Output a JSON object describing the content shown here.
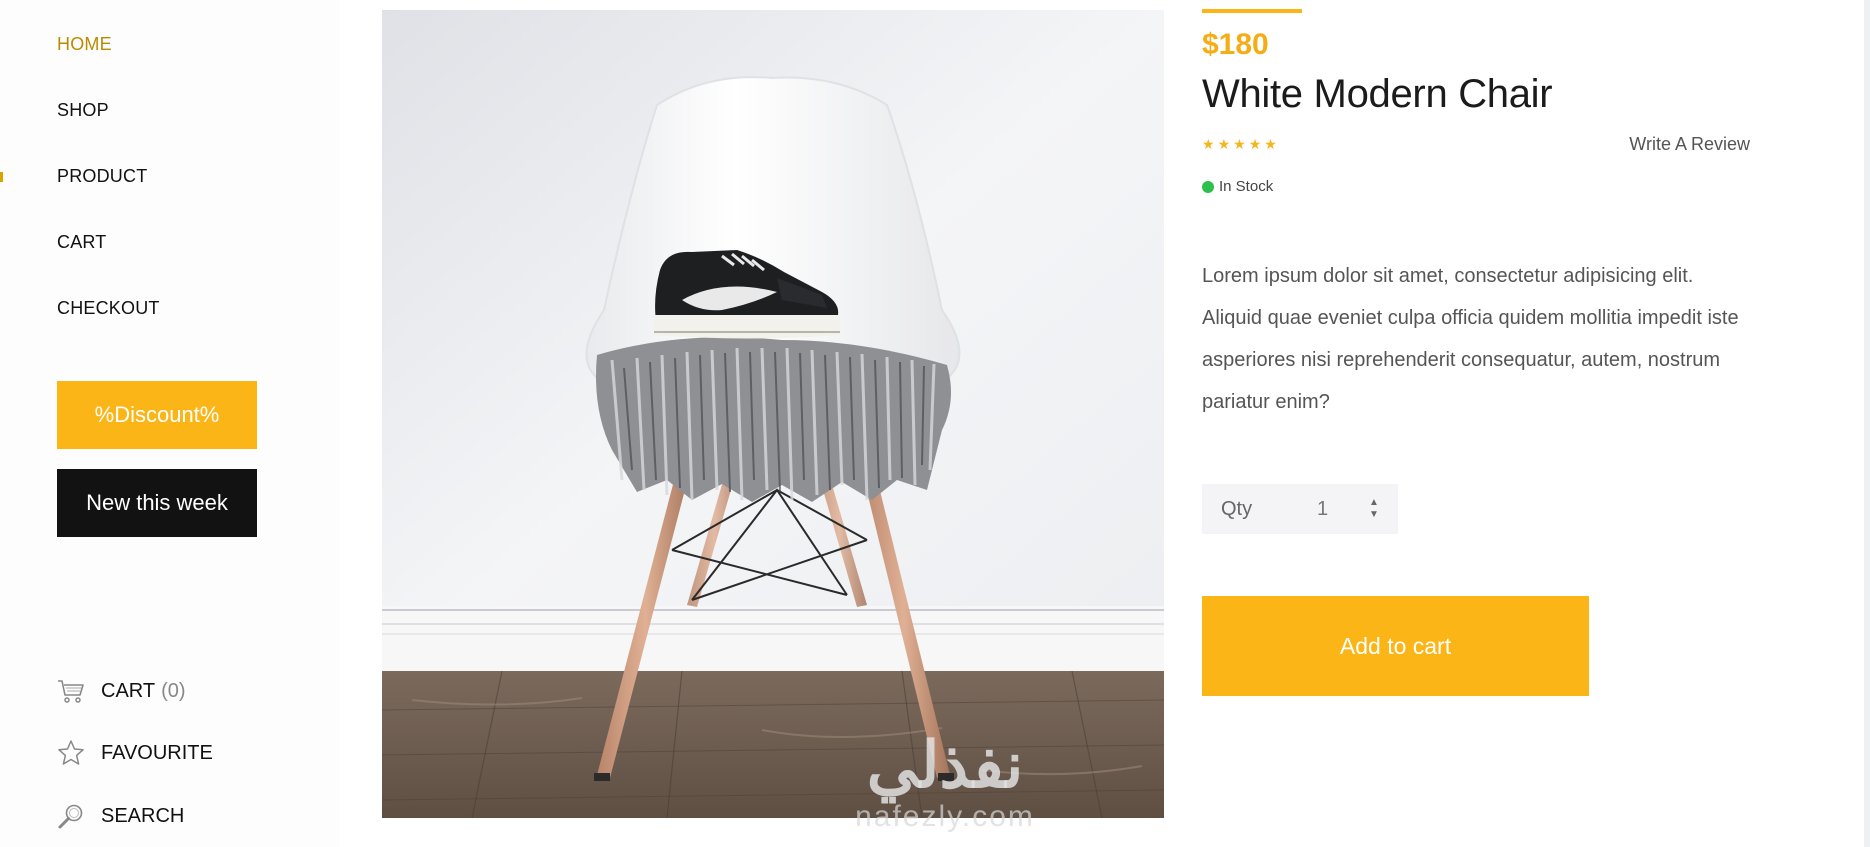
{
  "nav": {
    "items": [
      {
        "label": "HOME",
        "active": true
      },
      {
        "label": "SHOP",
        "active": false
      },
      {
        "label": "PRODUCT",
        "active": false
      },
      {
        "label": "CART",
        "active": false
      },
      {
        "label": "CHECKOUT",
        "active": false
      }
    ]
  },
  "promos": {
    "discount_label": "%Discount%",
    "new_label": "New this week"
  },
  "utilities": {
    "cart_label": "CART",
    "cart_count": "(0)",
    "favourite_label": "FAVOURITE",
    "search_label": "SEARCH"
  },
  "product": {
    "price": "$180",
    "title": "White Modern Chair",
    "rating": 5,
    "review_link": "Write A Review",
    "stock": "In Stock",
    "description": "Lorem ipsum dolor sit amet, consectetur adipisicing elit. Aliquid quae eveniet culpa officia quidem mollitia impedit iste asperiores nisi reprehenderit consequatur, autem, nostrum pariatur enim?",
    "qty_label": "Qty",
    "qty_value": "1",
    "add_to_cart": "Add to cart"
  },
  "watermark": {
    "arabic": "نفذلي",
    "latin": "nafezly.com"
  },
  "colors": {
    "accent": "#fbb516",
    "active_nav": "#b98b00",
    "dark": "#121212",
    "in_stock": "#2ec04f"
  },
  "icons": [
    "cart-icon",
    "star-icon",
    "search-icon",
    "star-rating-icon",
    "chevron-up-icon",
    "chevron-down-icon"
  ]
}
